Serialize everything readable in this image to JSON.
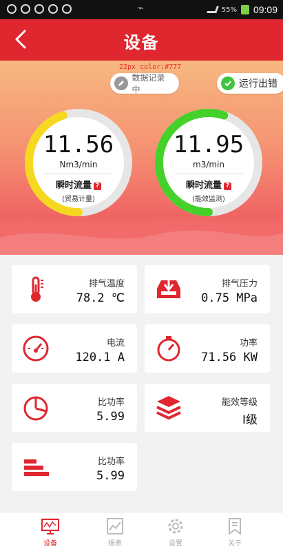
{
  "status_bar": {
    "battery": "55%",
    "time": "09:09"
  },
  "header": {
    "title": "设备"
  },
  "annotation": "22px color:#777",
  "badges": {
    "recording": "数据记录中",
    "running_error": "运行出错"
  },
  "gauges": [
    {
      "value": "11.56",
      "unit": "Nm3/min",
      "label": "瞬时流量",
      "sublabel": "(贸易计量)",
      "help": "?",
      "arc_color": "#f6d820",
      "fill_fraction": 0.45
    },
    {
      "value": "11.95",
      "unit": "m3/min",
      "label": "瞬时流量",
      "sublabel": "(能效监测)",
      "help": "?",
      "arc_color": "#44d12a",
      "fill_fraction": 0.55
    }
  ],
  "cards": [
    {
      "icon": "thermometer-icon",
      "label": "排气温度",
      "value": "78.2 ℃"
    },
    {
      "icon": "pressure-tray-icon",
      "label": "排气压力",
      "value": "0.75 MPa"
    },
    {
      "icon": "speedometer-icon",
      "label": "电流",
      "value": "120.1 A"
    },
    {
      "icon": "power-timer-icon",
      "label": "功率",
      "value": "71.56 KW"
    },
    {
      "icon": "pie-chart-icon",
      "label": "比功率",
      "value": "5.99"
    },
    {
      "icon": "layers-icon",
      "label": "能效等级",
      "value": "Ⅰ级"
    },
    {
      "icon": "bar-levels-icon",
      "label": "比功率",
      "value": "5.99"
    }
  ],
  "tabs": [
    {
      "label": "设备",
      "icon": "monitor-icon",
      "active": true
    },
    {
      "label": "报表",
      "icon": "report-icon",
      "active": false
    },
    {
      "label": "设置",
      "icon": "gear-icon",
      "active": false
    },
    {
      "label": "关于",
      "icon": "bookmark-icon",
      "active": false
    }
  ],
  "colors": {
    "brand": "#e0262f",
    "gauge_ring": "#e6e6e6"
  }
}
